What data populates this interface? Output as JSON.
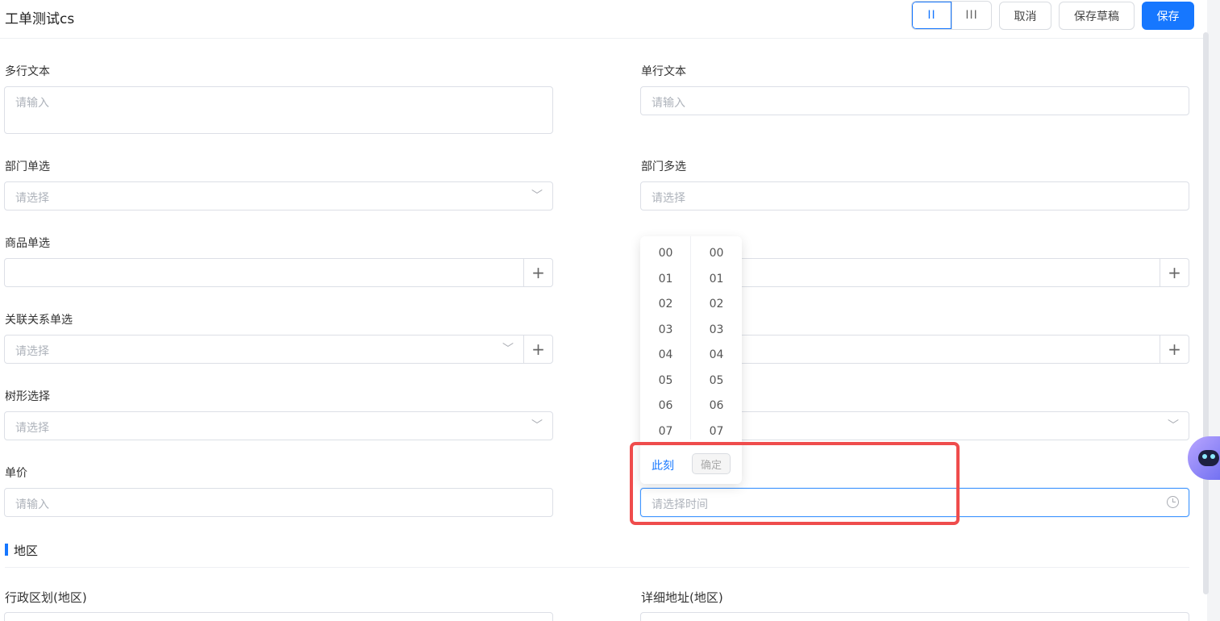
{
  "header": {
    "title": "工单测试cs",
    "layout_two_col": "II",
    "layout_three_col": "III",
    "cancel_label": "取消",
    "save_draft_label": "保存草稿",
    "save_label": "保存"
  },
  "form": {
    "multiline_text": {
      "label": "多行文本",
      "placeholder": "请输入"
    },
    "single_line_text": {
      "label": "单行文本",
      "placeholder": "请输入"
    },
    "dept_single": {
      "label": "部门单选",
      "placeholder": "请选择"
    },
    "dept_multi": {
      "label": "部门多选",
      "placeholder": "请选择"
    },
    "product_single": {
      "label": "商品单选",
      "placeholder": ""
    },
    "relation_single": {
      "label": "关联关系单选",
      "placeholder": "请选择"
    },
    "tree_select": {
      "label": "树形选择",
      "placeholder": "请选择"
    },
    "unit_price": {
      "label": "单价",
      "placeholder": "请输入"
    },
    "time_field": {
      "placeholder": "请选择时间"
    }
  },
  "section": {
    "title": "地区"
  },
  "region": {
    "admin_division_label": "行政区划(地区)",
    "detail_address_label": "详细地址(地区)"
  },
  "time_picker": {
    "hours": [
      "00",
      "01",
      "02",
      "03",
      "04",
      "05",
      "06",
      "07"
    ],
    "minutes": [
      "00",
      "01",
      "02",
      "03",
      "04",
      "05",
      "06",
      "07"
    ],
    "now_label": "此刻",
    "confirm_label": "确定"
  },
  "colors": {
    "primary": "#1677ff",
    "highlight": "#ef4c4c"
  },
  "icons": {
    "chevron": "chevron-down-icon",
    "plus": "plus-icon",
    "clock": "clock-icon"
  }
}
